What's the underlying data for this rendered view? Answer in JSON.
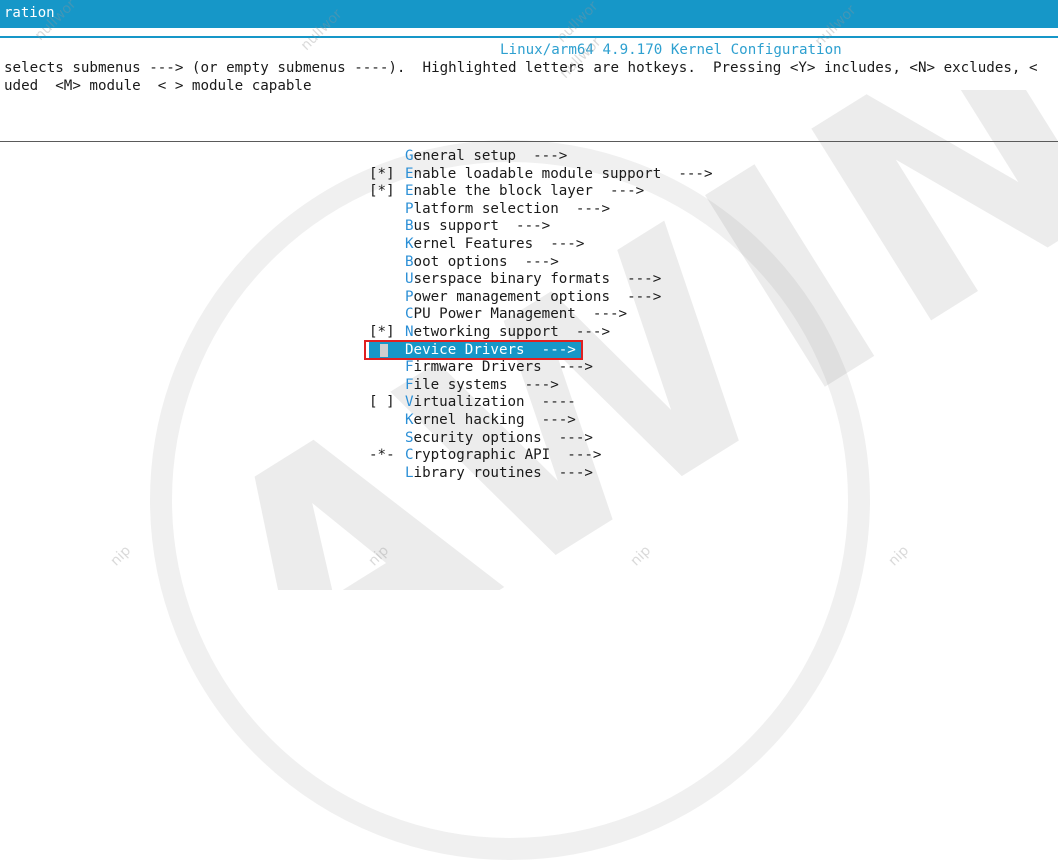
{
  "window": {
    "title": "ration"
  },
  "kconfig": {
    "title": "Linux/arm64 4.9.170 Kernel Configuration"
  },
  "help": {
    "line1": "selects submenus ---> (or empty submenus ----).  Highlighted letters are hotkeys.  Pressing <Y> includes, <N> excludes, <",
    "line2": "uded  <M> module  < > module capable"
  },
  "menu": {
    "items": [
      {
        "mark": "",
        "hot": "G",
        "rest": "eneral setup",
        "arrow": "  --->"
      },
      {
        "mark": "[*]",
        "hot": "E",
        "rest": "nable loadable module support",
        "arrow": "  --->"
      },
      {
        "mark": "[*]",
        "hot": "E",
        "rest": "nable the block layer",
        "arrow": "  --->"
      },
      {
        "mark": "",
        "hot": "P",
        "rest": "latform selection",
        "arrow": "  --->"
      },
      {
        "mark": "",
        "hot": "B",
        "rest": "us support",
        "arrow": "  --->"
      },
      {
        "mark": "",
        "hot": "K",
        "rest": "ernel Features",
        "arrow": "  --->"
      },
      {
        "mark": "",
        "hot": "B",
        "rest": "oot options",
        "arrow": "  --->"
      },
      {
        "mark": "",
        "hot": "U",
        "rest": "serspace binary formats",
        "arrow": "  --->"
      },
      {
        "mark": "",
        "hot": "P",
        "rest": "ower management options",
        "arrow": "  --->"
      },
      {
        "mark": "",
        "hot": "C",
        "rest": "PU Power Management",
        "arrow": "  --->"
      },
      {
        "mark": "[*]",
        "hot": "N",
        "rest": "etworking support",
        "arrow": "  --->"
      },
      {
        "mark": "",
        "hot": "D",
        "rest": "evice Drivers",
        "arrow": "  --->",
        "selected": true
      },
      {
        "mark": "",
        "hot": "F",
        "rest": "irmware Drivers",
        "arrow": "  --->"
      },
      {
        "mark": "",
        "hot": "F",
        "rest": "ile systems",
        "arrow": "  --->"
      },
      {
        "mark": "[ ]",
        "hot": "V",
        "rest": "irtualization",
        "arrow": "  ----"
      },
      {
        "mark": "",
        "hot": "K",
        "rest": "ernel hacking",
        "arrow": "  --->"
      },
      {
        "mark": "",
        "hot": "S",
        "rest": "ecurity options",
        "arrow": "  --->"
      },
      {
        "mark": "-*-",
        "hot": "C",
        "rest": "ryptographic API",
        "arrow": "  --->"
      },
      {
        "mark": "",
        "hot": "L",
        "rest": "ibrary routines",
        "arrow": "  --->"
      }
    ]
  },
  "watermark": {
    "brand": "AWINE",
    "tags": [
      "nullwor",
      "nullwor",
      "nullwor",
      "nullwor",
      "nullwor",
      "nip",
      "nip",
      "nip",
      "nip"
    ]
  },
  "colors": {
    "accent": "#1697c8",
    "hotkey": "#2b8fd6",
    "selection_box": "#e02020"
  }
}
